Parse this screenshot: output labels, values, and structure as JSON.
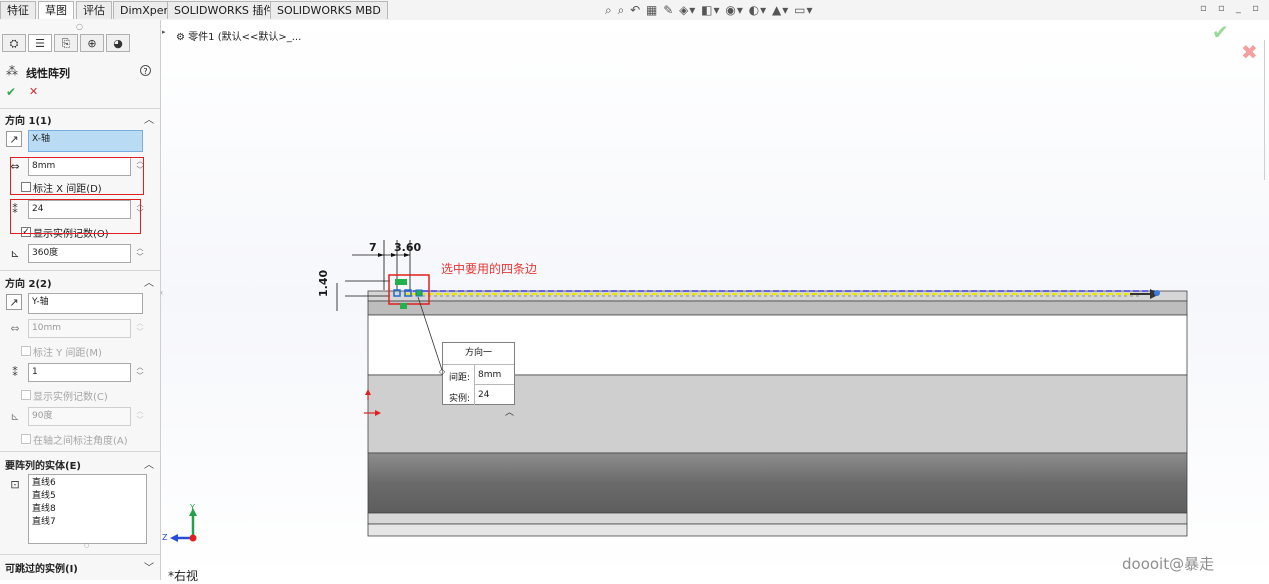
{
  "command_tabs": [
    "特征",
    "草图",
    "评估",
    "DimXpert",
    "SOLIDWORKS 插件",
    "SOLIDWORKS MBD"
  ],
  "active_tab": "草图",
  "feature_tree": {
    "item": "零件1  (默认<<默认>_..."
  },
  "property_manager": {
    "title": "线性阵列",
    "help": "?",
    "ok": "✔",
    "cancel": "✕",
    "direction1": {
      "title": "方向 1(1)",
      "axis": "X-轴",
      "spacing": "8mm",
      "dimension_spacing_label": "标注 X 间距(D)",
      "dimension_spacing_checked": false,
      "instances": "24",
      "display_count_label": "显示实例记数(O)",
      "display_count_checked": true,
      "angle": "360度"
    },
    "direction2": {
      "title": "方向 2(2)",
      "axis": "Y-轴",
      "spacing": "10mm",
      "dimension_spacing_label": "标注 Y 间距(M)",
      "instances": "1",
      "display_count_label": "显示实例记数(C)",
      "angle": "90度",
      "fix_angle_label": "在轴之间标注角度(A)"
    },
    "entities": {
      "title": "要阵列的实体(E)",
      "items": [
        "直线6",
        "直线5",
        "直线8",
        "直线7"
      ]
    },
    "skip_instances": {
      "title": "可跳过的实例(I)"
    }
  },
  "graphics": {
    "dimensions": {
      "d1": "7",
      "d2": "3.60",
      "d3": "1.40"
    },
    "annotation": "选中要用的四条边",
    "callout": {
      "title": "方向一",
      "spacing_label": "间距:",
      "spacing_value": "8mm",
      "instances_label": "实例:",
      "instances_value": "24"
    },
    "triad": {
      "y": "Y",
      "z": "Z"
    },
    "view_name": "*右视"
  },
  "watermark": "doooit@暴走",
  "colors": {
    "accent_red": "#e53935",
    "ok_green": "#34a853",
    "selection_blue": "#b9dcf4",
    "preview_yellow": "#e8e800",
    "preview_blue": "#3a3ae0"
  },
  "icons": [
    "feature-manager-icon",
    "property-manager-icon",
    "configuration-manager-icon",
    "dimxpert-icon",
    "display-manager-icon",
    "linear-pattern-icon",
    "help-icon",
    "direction-arrow-icon",
    "spacing-icon",
    "instances-icon",
    "angle-icon",
    "entities-icon",
    "part-icon",
    "zoom-icon",
    "view-orientation-icon"
  ]
}
